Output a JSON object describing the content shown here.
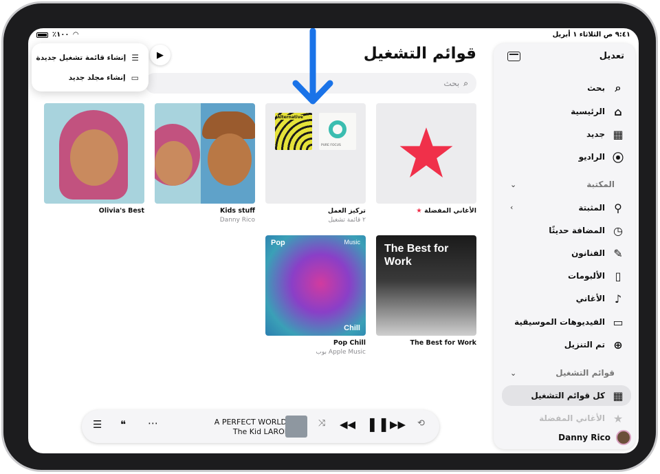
{
  "status": {
    "time_date": "٩:٤١ ص  الثلاثاء ١ أبريل",
    "battery": "٪١٠٠"
  },
  "sidebar": {
    "edit_label": "تعديل",
    "nav": [
      {
        "label": "بحث",
        "icon": "search-icon"
      },
      {
        "label": "الرئيسية",
        "icon": "home-icon"
      },
      {
        "label": "جديد",
        "icon": "grid-icon"
      },
      {
        "label": "الراديو",
        "icon": "radio-icon"
      }
    ],
    "library_header": "المكتبة",
    "library": [
      {
        "label": "المثبتة",
        "icon": "pin-icon"
      },
      {
        "label": "المضافة حديثًا",
        "icon": "clock-icon"
      },
      {
        "label": "الفنانون",
        "icon": "microphone-icon"
      },
      {
        "label": "الألبومات",
        "icon": "album-icon"
      },
      {
        "label": "الأغاني",
        "icon": "note-icon"
      },
      {
        "label": "الفيديوهات الموسيقية",
        "icon": "tv-icon"
      },
      {
        "label": "تم التنزيل",
        "icon": "download-icon"
      }
    ],
    "playlists_header": "قوائم التشغيل",
    "all_playlists": "كل قوائم التشغيل",
    "favorites_faded": "الأغاني المفضلة",
    "user_name": "Danny Rico"
  },
  "main": {
    "title": "قوائم التشغيل",
    "search_placeholder": "بحث"
  },
  "menu": {
    "new_playlist": "إنشاء قائمة تشغيل جديدة",
    "new_folder": "إنشاء مجلد جديد"
  },
  "tiles": [
    {
      "title": "الأغاني المفضلة",
      "subtitle": ""
    },
    {
      "title": "تركيز العمل",
      "subtitle": "٢ قائمة تشغيل",
      "mini1": "Alternative",
      "mini2": "PURE FOCUS"
    },
    {
      "title": "Kids stuff",
      "subtitle": "Danny Rico"
    },
    {
      "title": "Olivia's Best",
      "subtitle": ""
    },
    {
      "title": "The Best for Work",
      "subtitle": "",
      "art_text": "The Best for Work"
    },
    {
      "title": "Pop Chill",
      "subtitle": "بوب Apple Music",
      "art_pop": "Pop",
      "art_brand": "Music",
      "art_chill": "Chill"
    }
  ],
  "player": {
    "song": "A PERFECT WORLD",
    "artist": "The Kid LAROI"
  },
  "colors": {
    "accent_arrow": "#1a73e8",
    "star": "#f0304a"
  }
}
